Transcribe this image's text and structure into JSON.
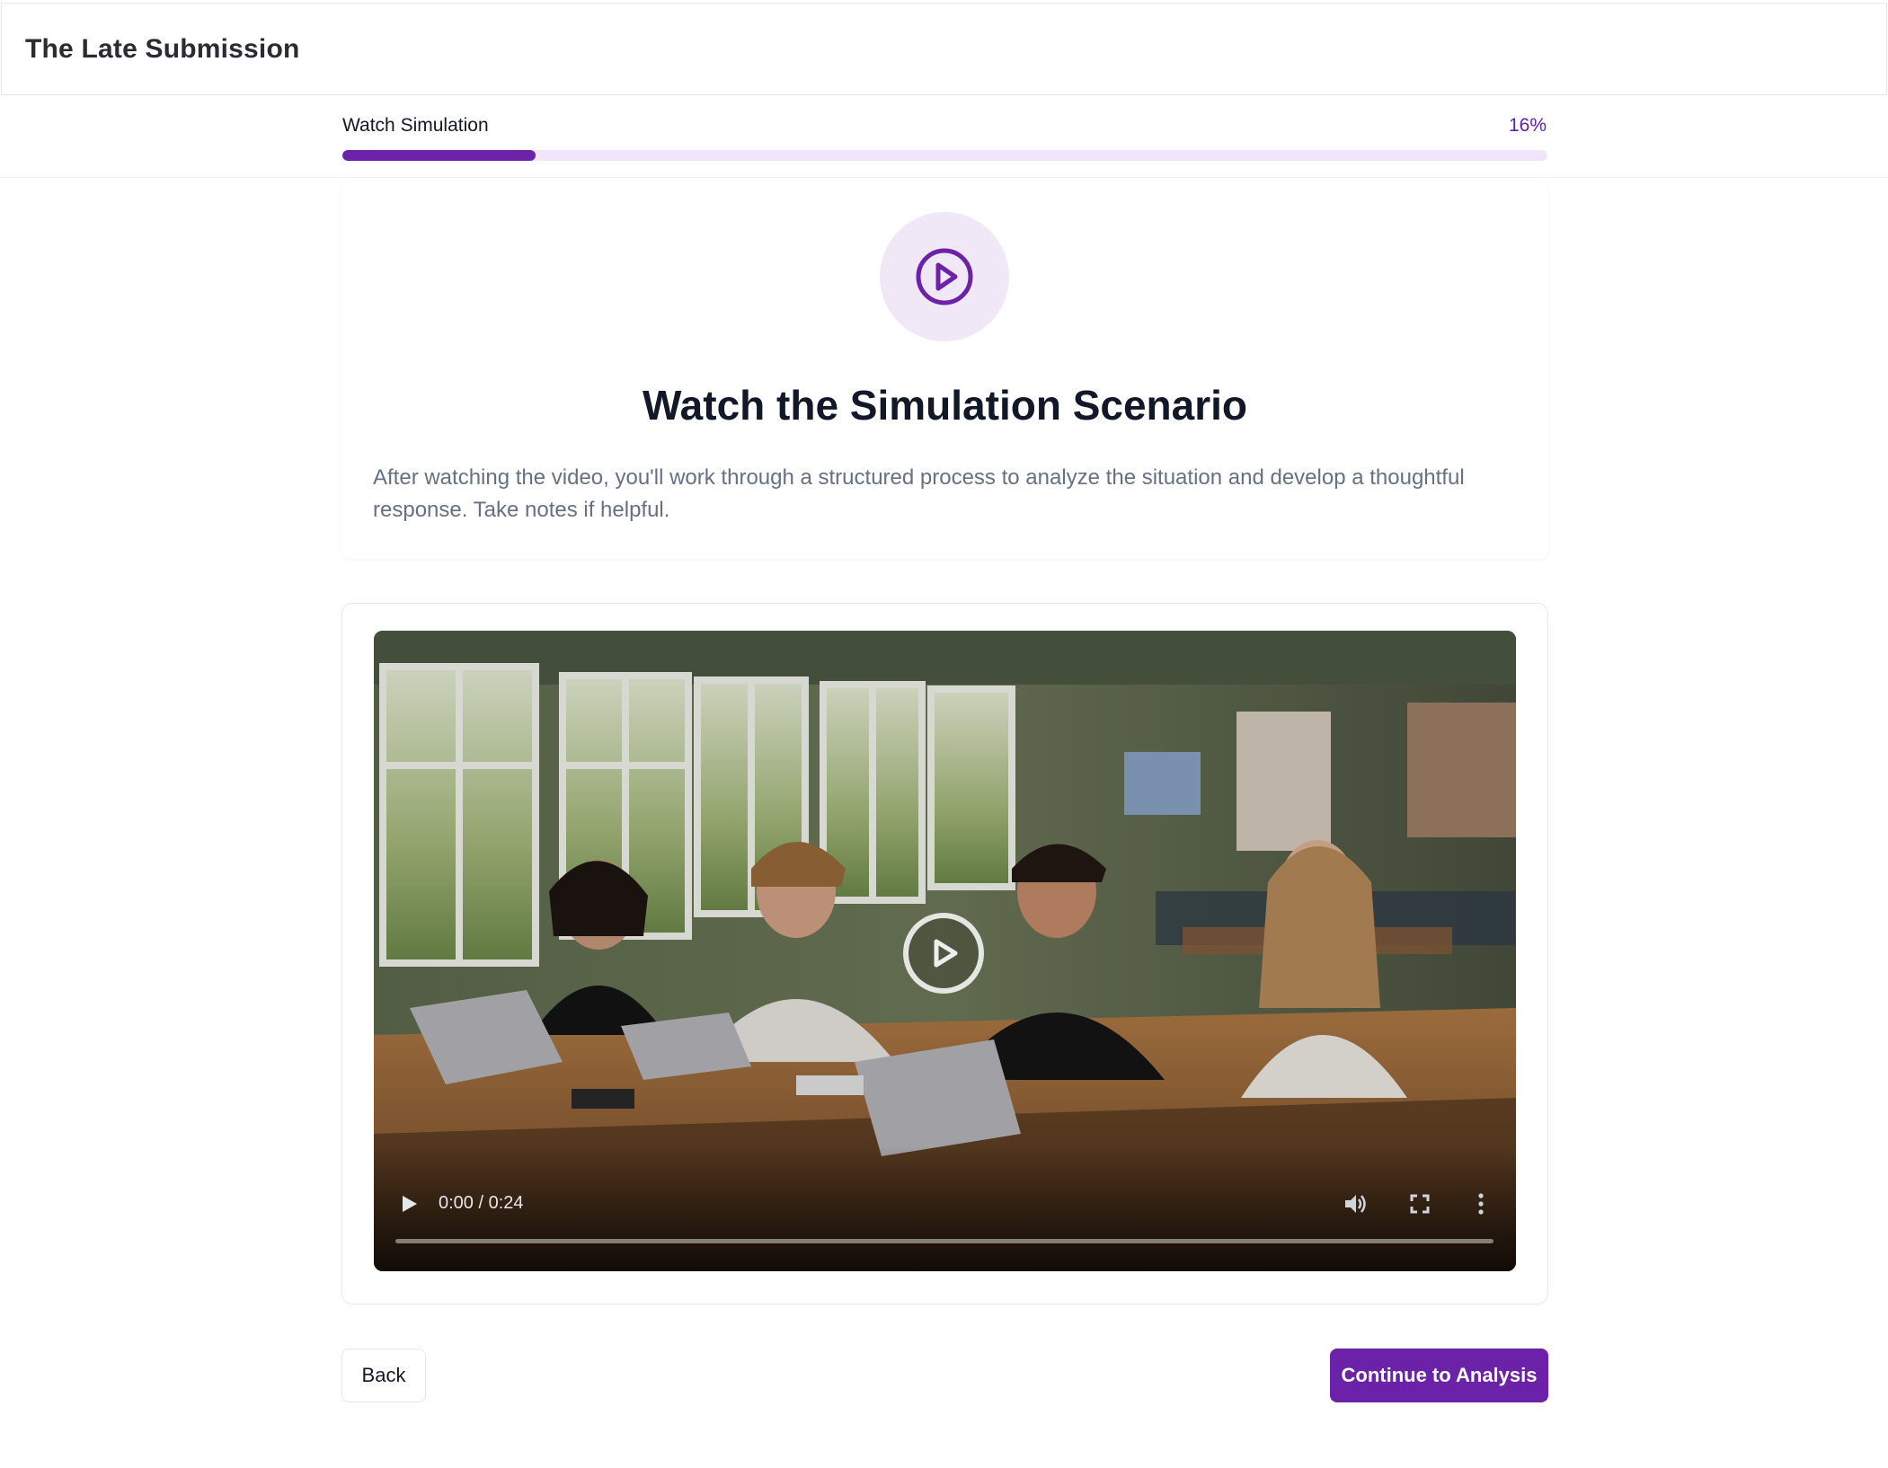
{
  "app": {
    "title": "The Late Submission"
  },
  "progress": {
    "step_label": "Watch Simulation",
    "percent_label": "16%",
    "value": 0.16
  },
  "intro": {
    "icon": "play-circle-icon",
    "title": "Watch the Simulation Scenario",
    "description": "After watching the video, you'll work through a structured process to analyze the situation and develop a thoughtful response. Take notes if helpful."
  },
  "video": {
    "time_display": "0:00 / 0:24",
    "current_time": "0:00",
    "duration": "0:24",
    "progress": 0,
    "icons": [
      "play-icon",
      "volume-icon",
      "fullscreen-icon",
      "more-options-icon",
      "big-play-icon"
    ]
  },
  "actions": {
    "back_label": "Back",
    "continue_label": "Continue to Analysis"
  },
  "colors": {
    "accent": "#6b21a8",
    "progress_track": "#f1e4fb",
    "icon_circle_bg": "#f0e8f6",
    "muted_text": "#667085"
  }
}
